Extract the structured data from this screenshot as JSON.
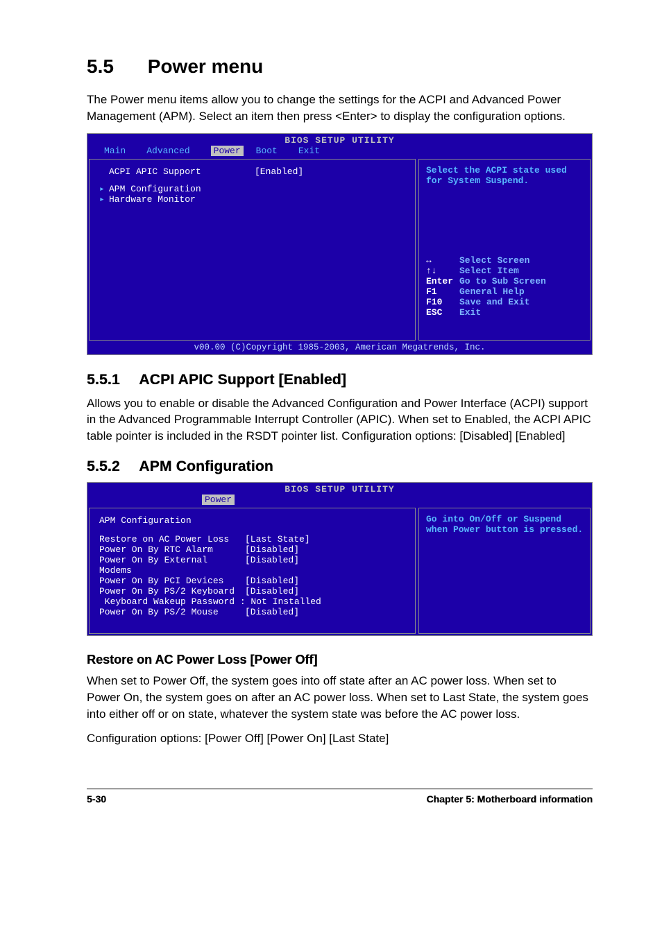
{
  "section": {
    "number": "5.5",
    "title": "Power menu",
    "intro": "The Power menu items allow you to change the settings for the ACPI and Advanced Power Management (APM). Select an item then press <Enter> to display the configuration options."
  },
  "bios1": {
    "title": "BIOS SETUP UTILITY",
    "tabs": [
      "Main",
      "Advanced",
      "Power",
      "Boot",
      "Exit"
    ],
    "active_tab": "Power",
    "items": [
      {
        "label": "ACPI APIC Support",
        "value": "[Enabled]",
        "submenu": false
      },
      {
        "label": "APM Configuration",
        "value": "",
        "submenu": true
      },
      {
        "label": "Hardware Monitor",
        "value": "",
        "submenu": true
      }
    ],
    "help": "Select the ACPI state used for System Suspend.",
    "nav": [
      {
        "key": "↔",
        "desc": "Select Screen"
      },
      {
        "key": "↑↓",
        "desc": "Select Item"
      },
      {
        "key": "Enter",
        "desc": "Go to Sub Screen"
      },
      {
        "key": "F1",
        "desc": "General Help"
      },
      {
        "key": "F10",
        "desc": "Save and Exit"
      },
      {
        "key": "ESC",
        "desc": "Exit"
      }
    ],
    "footer": "v00.00 (C)Copyright 1985-2003, American Megatrends, Inc."
  },
  "sub1": {
    "number": "5.5.1",
    "title": "ACPI APIC Support [Enabled]",
    "body": "Allows you to enable or disable the Advanced Configuration and Power Interface (ACPI) support in the Advanced Programmable Interrupt Controller (APIC). When set to Enabled, the ACPI APIC table pointer is included in the RSDT pointer list. Configuration options: [Disabled] [Enabled]"
  },
  "sub2": {
    "number": "5.5.2",
    "title": "APM Configuration"
  },
  "bios2": {
    "title": "BIOS SETUP UTILITY",
    "active_tab": "Power",
    "heading": "APM Configuration",
    "items": [
      {
        "label": "Restore on AC Power Loss",
        "value": "[Last State]"
      },
      {
        "label": "Power On By RTC Alarm",
        "value": "[Disabled]"
      },
      {
        "label": "Power On By External Modems",
        "value": "[Disabled]"
      },
      {
        "label": "Power On By PCI Devices",
        "value": "[Disabled]"
      },
      {
        "label": "Power On By PS/2 Keyboard",
        "value": "[Disabled]"
      },
      {
        "label": " Keyboard Wakeup Password : Not Installed",
        "value": ""
      },
      {
        "label": "Power On By PS/2 Mouse",
        "value": "[Disabled]"
      }
    ],
    "help": "Go into On/Off or Suspend when Power button is pressed."
  },
  "opt1": {
    "title": "Restore on AC Power Loss [Power Off]",
    "body": "When set to Power Off, the system goes into off state after an AC power loss. When set to Power On, the system goes on after an AC power loss. When set to Last State, the system goes into either off or on state, whatever the system state was before the AC power loss.",
    "config": "Configuration options: [Power Off] [Power On] [Last State]"
  },
  "footer": {
    "page": "5-30",
    "chapter": "Chapter 5: Motherboard information"
  }
}
